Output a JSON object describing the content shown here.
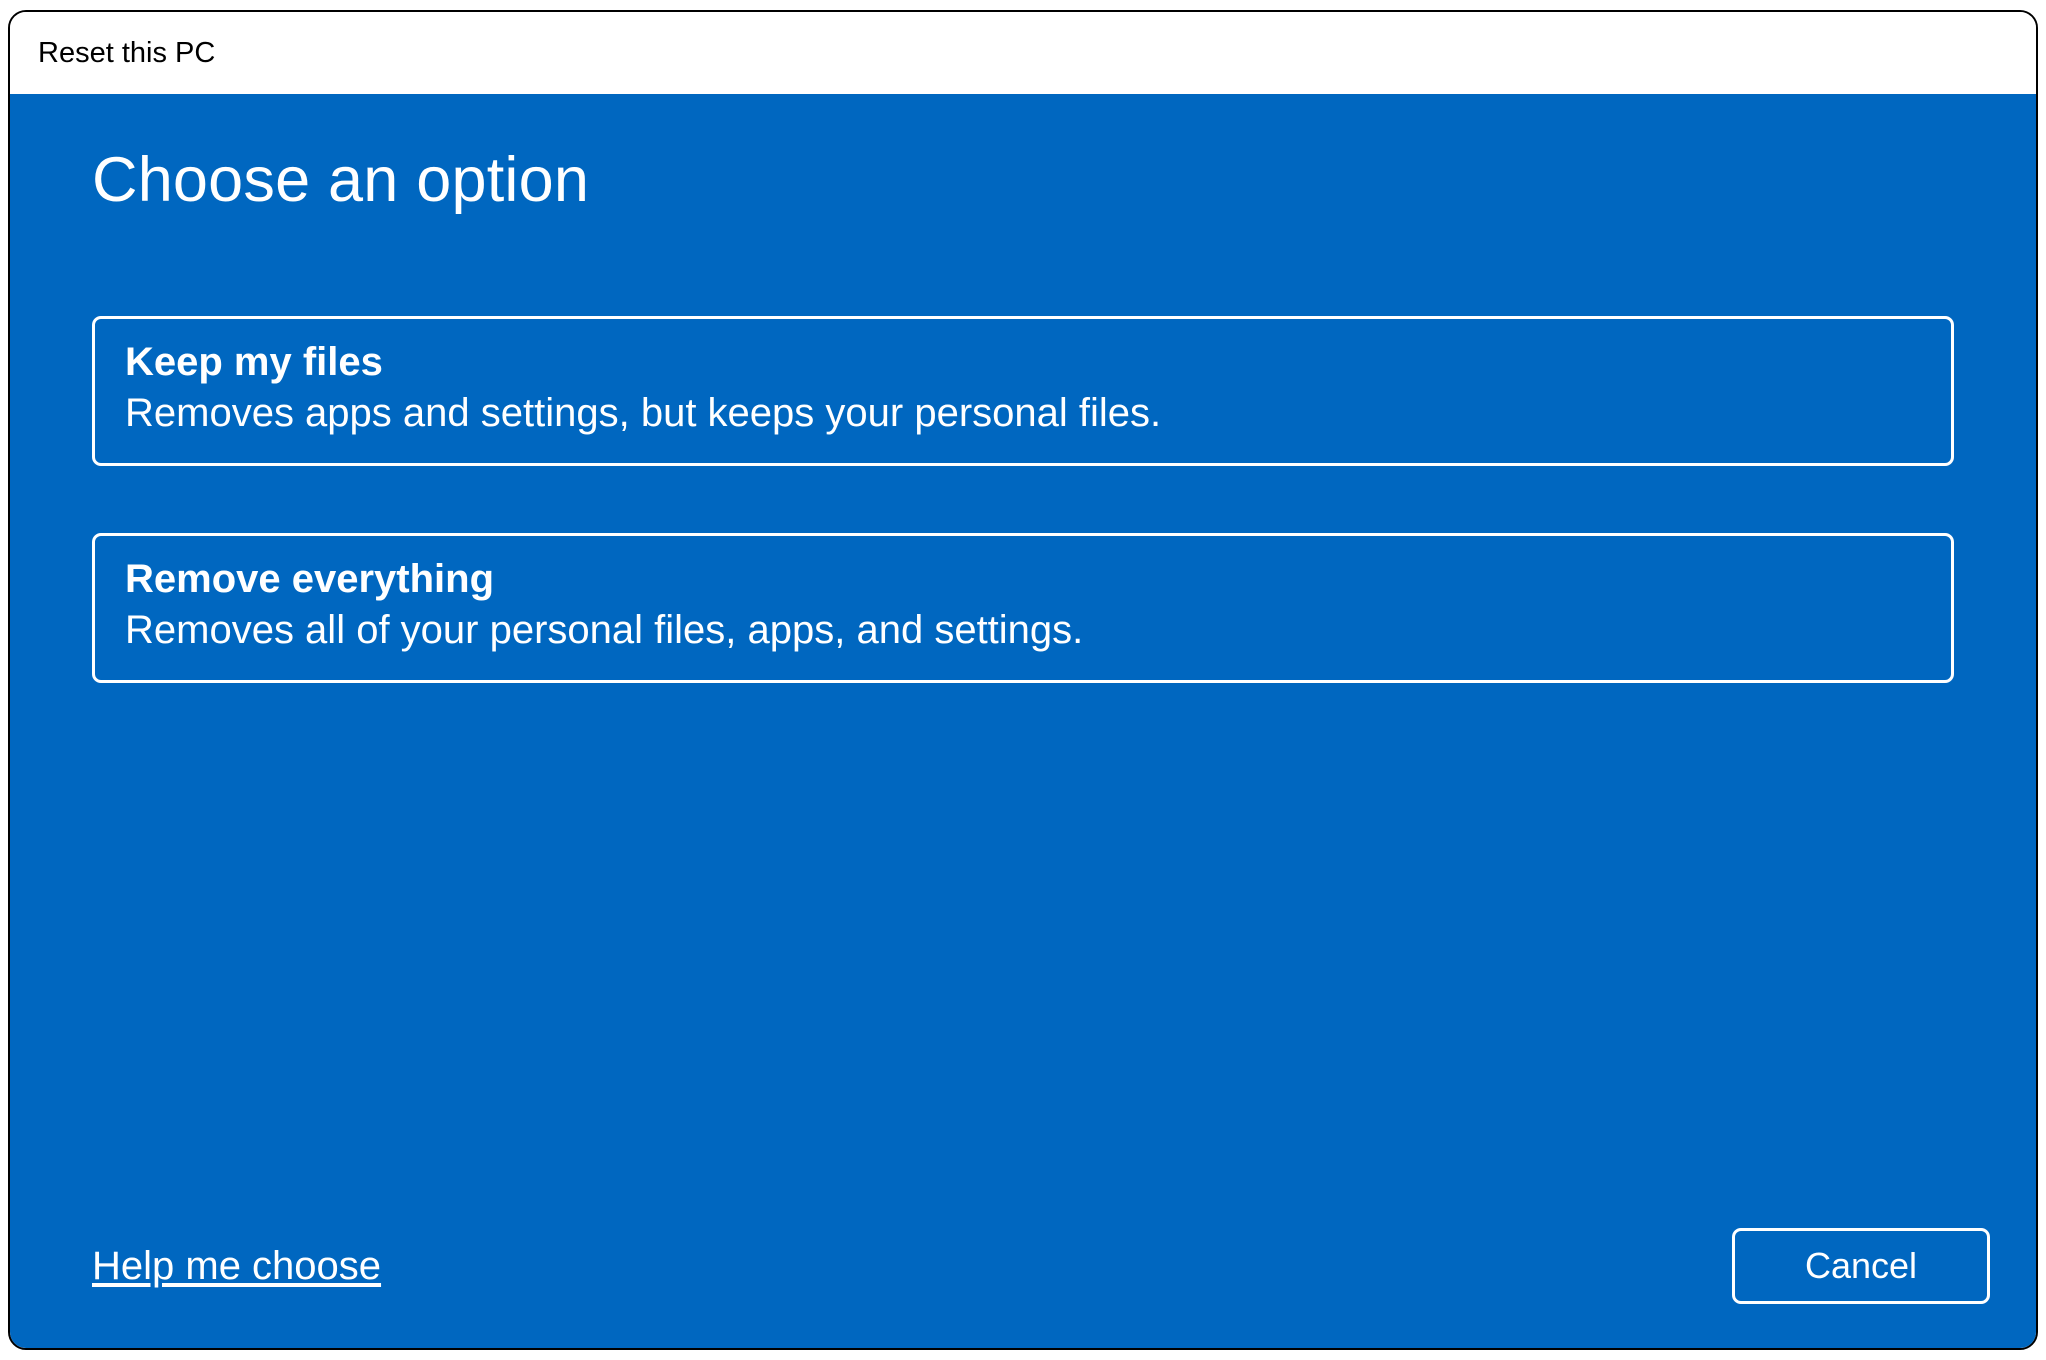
{
  "window": {
    "title": "Reset this PC"
  },
  "main": {
    "heading": "Choose an option",
    "options": [
      {
        "title": "Keep my files",
        "description": "Removes apps and settings, but keeps your personal files."
      },
      {
        "title": "Remove everything",
        "description": "Removes all of your personal files, apps, and settings."
      }
    ]
  },
  "footer": {
    "help_link": "Help me choose",
    "cancel_label": "Cancel"
  }
}
